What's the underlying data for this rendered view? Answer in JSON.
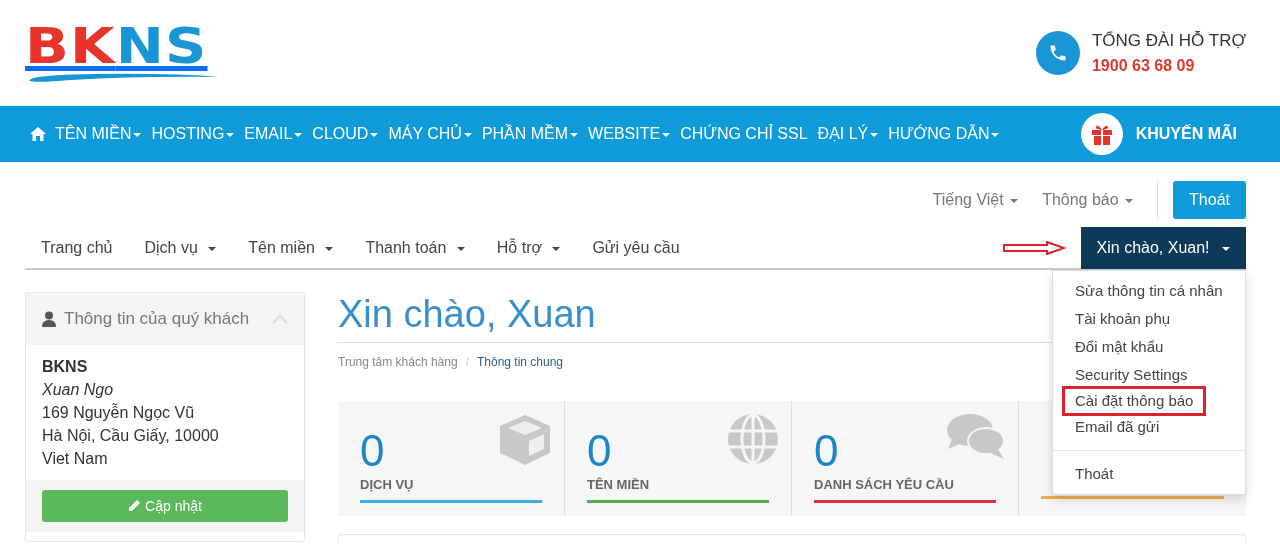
{
  "logo": {
    "parts": [
      {
        "text": "BK",
        "color": "#e8352b"
      },
      {
        "text": "NS",
        "color": "#1a95d5"
      }
    ]
  },
  "hotline": {
    "label": "TỔNG ĐÀI HỖ TRỢ",
    "number": "1900 63 68 09"
  },
  "main_nav": {
    "items": [
      {
        "label": "TÊN MIỀN",
        "dropdown": true
      },
      {
        "label": "HOSTING",
        "dropdown": true
      },
      {
        "label": "EMAIL",
        "dropdown": true
      },
      {
        "label": "CLOUD",
        "dropdown": true
      },
      {
        "label": "MÁY CHỦ",
        "dropdown": true
      },
      {
        "label": "PHẦN MỀM",
        "dropdown": true
      },
      {
        "label": "WEBSITE",
        "dropdown": true
      },
      {
        "label": "CHỨNG CHỈ SSL",
        "dropdown": false
      },
      {
        "label": "ĐẠI LÝ",
        "dropdown": true
      },
      {
        "label": "HƯỚNG DẪN",
        "dropdown": true
      }
    ],
    "promo": "KHUYẾN MÃI"
  },
  "top_links": [
    {
      "label": "Tiếng Việt"
    },
    {
      "label": "Thông báo"
    }
  ],
  "logout_button": "Thoát",
  "account_nav": {
    "items": [
      {
        "label": "Trang chủ",
        "dropdown": false
      },
      {
        "label": "Dịch vụ",
        "dropdown": true
      },
      {
        "label": "Tên miền",
        "dropdown": true
      },
      {
        "label": "Thanh toán",
        "dropdown": true
      },
      {
        "label": "Hỗ trợ",
        "dropdown": true
      },
      {
        "label": "Gửi yêu cầu",
        "dropdown": false
      }
    ],
    "user_menu": {
      "label": "Xin chào, Xuan!",
      "expanded": true,
      "items": [
        {
          "label": "Sửa thông tin cá nhân",
          "highlighted": false
        },
        {
          "label": "Tài khoản phụ",
          "highlighted": false
        },
        {
          "label": "Đổi mật khẩu",
          "highlighted": false
        },
        {
          "label": "Security Settings",
          "highlighted": false
        },
        {
          "label": "Cài đặt thông báo",
          "highlighted": true
        },
        {
          "label": "Email đã gửi",
          "highlighted": false
        },
        {
          "label": "Thoát",
          "highlighted": false,
          "separated": true
        }
      ]
    }
  },
  "customer_card": {
    "title": "Thông tin của quý khách",
    "lines": [
      {
        "kind": "company",
        "text": "BKNS"
      },
      {
        "kind": "name",
        "text": "Xuan Ngo"
      },
      {
        "kind": "address",
        "text": "169 Nguyễn Ngọc Vũ"
      },
      {
        "kind": "address",
        "text": "Hà Nội, Cầu Giấy, 10000"
      },
      {
        "kind": "address",
        "text": "Viet Nam"
      }
    ],
    "button": "Cập nhật"
  },
  "page_title": "Xin chào, Xuan",
  "breadcrumb": {
    "separator": "/",
    "items": [
      {
        "label": "Trung tâm khách hàng",
        "selected": false
      },
      {
        "label": "Thông tin chung",
        "selected": true
      }
    ]
  },
  "stats": [
    {
      "value": "0",
      "label": "DỊCH VỤ",
      "color": "#3bafe0"
    },
    {
      "value": "0",
      "label": "TÊN MIỀN",
      "color": "#4cae4c"
    },
    {
      "value": "0",
      "label": "DANH SÁCH YÊU CẦU",
      "color": "#d9333f"
    },
    {
      "color": "#f0ad4e"
    }
  ]
}
